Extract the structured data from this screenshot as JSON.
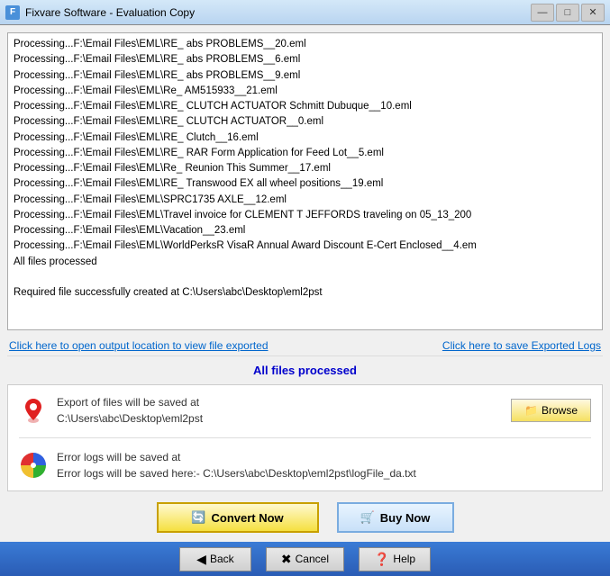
{
  "titleBar": {
    "icon": "F",
    "title": "Fixvare Software - Evaluation Copy",
    "minimize": "—",
    "maximize": "□",
    "close": "✕"
  },
  "logLines": [
    "Processing...F:\\Email Files\\EML\\RE_ abs PROBLEMS__20.eml",
    "Processing...F:\\Email Files\\EML\\RE_ abs PROBLEMS__6.eml",
    "Processing...F:\\Email Files\\EML\\RE_ abs PROBLEMS__9.eml",
    "Processing...F:\\Email Files\\EML\\Re_ AM515933__21.eml",
    "Processing...F:\\Email Files\\EML\\RE_ CLUTCH ACTUATOR Schmitt Dubuque__10.eml",
    "Processing...F:\\Email Files\\EML\\RE_ CLUTCH ACTUATOR__0.eml",
    "Processing...F:\\Email Files\\EML\\RE_ Clutch__16.eml",
    "Processing...F:\\Email Files\\EML\\RE_ RAR Form Application for Feed Lot__5.eml",
    "Processing...F:\\Email Files\\EML\\Re_ Reunion This Summer__17.eml",
    "Processing...F:\\Email Files\\EML\\RE_ Transwood EX all wheel positions__19.eml",
    "Processing...F:\\Email Files\\EML\\SPRC1735 AXLE__12.eml",
    "Processing...F:\\Email Files\\EML\\Travel invoice for CLEMENT T JEFFORDS traveling on 05_13_200",
    "Processing...F:\\Email Files\\EML\\Vacation__23.eml",
    "Processing...F:\\Email Files\\EML\\WorldPerksR VisaR Annual Award Discount E-Cert Enclosed__4.em",
    "All files processed",
    "",
    "Required file successfully created at C:\\Users\\abc\\Desktop\\eml2pst"
  ],
  "links": {
    "openOutput": "Click here to open output location to view file exported",
    "saveLogs": "Click here to save Exported Logs"
  },
  "statusMessage": "All files processed",
  "exportInfo": {
    "label1": "Export of files will be saved at",
    "path1": "C:\\Users\\abc\\Desktop\\eml2pst",
    "browseLabel": "Browse",
    "label2": "Error logs will be saved at",
    "path2": "Error logs will be saved here:- C:\\Users\\abc\\Desktop\\eml2pst\\logFile_da.txt"
  },
  "buttons": {
    "convert": "Convert Now",
    "buy": "Buy Now",
    "back": "Back",
    "cancel": "Cancel",
    "help": "Help"
  }
}
